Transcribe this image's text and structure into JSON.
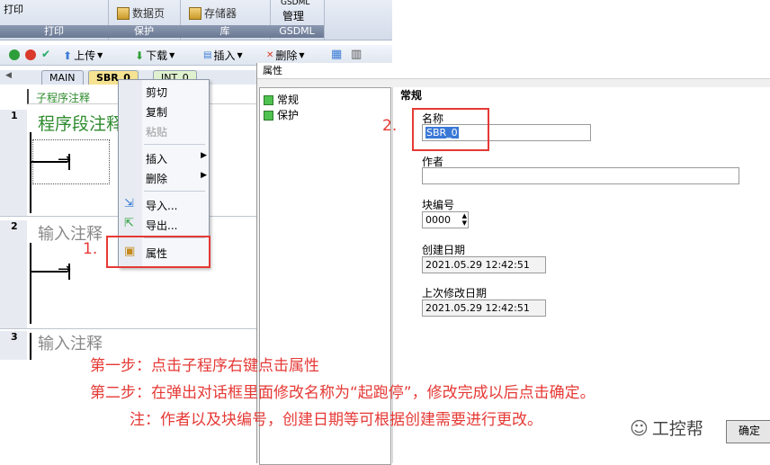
{
  "ribbon": {
    "top_left_text": "打印",
    "groups": [
      {
        "label": "打印",
        "buttons": []
      },
      {
        "label": "保护",
        "buttons": [
          "数据页"
        ]
      },
      {
        "label": "库",
        "buttons": [
          "存储器"
        ]
      },
      {
        "label": "GSDML",
        "buttons": [
          "GSDML 管理"
        ]
      }
    ],
    "gsdml_top": "GSDML",
    "gsdml_btn": "管理"
  },
  "toolbar": {
    "upload": "上传",
    "download": "下载",
    "insert": "插入",
    "delete": "删除"
  },
  "tabs": {
    "main": "MAIN",
    "sbr": "SBR_0",
    "int": "INT_0"
  },
  "editor": {
    "header_comment": "子程序注释",
    "networks": [
      {
        "num": "1",
        "comment": "程序段注释"
      },
      {
        "num": "2",
        "comment": "输入注释"
      },
      {
        "num": "3",
        "comment": "输入注释"
      }
    ]
  },
  "context_menu": {
    "items": [
      "剪切",
      "复制",
      "粘贴",
      "插入",
      "删除",
      "导入...",
      "导出...",
      "属性"
    ]
  },
  "dialog": {
    "title": "属性",
    "tree": [
      "常规",
      "保护"
    ],
    "section": "常规",
    "name_label": "名称",
    "name_value": "SBR_0",
    "author_label": "作者",
    "author_value": "",
    "block_label": "块编号",
    "block_value": "0000",
    "created_label": "创建日期",
    "created_value": "2021.05.29    12:42:51",
    "modified_label": "上次修改日期",
    "modified_value": "2021.05.29    12:42:51",
    "ok_button": "确定"
  },
  "annotations": {
    "marker1": "1.",
    "marker2": "2.",
    "step1": "第一步：点击子程序右键点击属性",
    "step2": "第二步：在弹出对话框里面修改名称为“起跑停”，修改完成以后点击确定。",
    "note": "注：作者以及块编号，创建日期等可根据创建需要进行更改。",
    "watermark": "工控帮"
  }
}
